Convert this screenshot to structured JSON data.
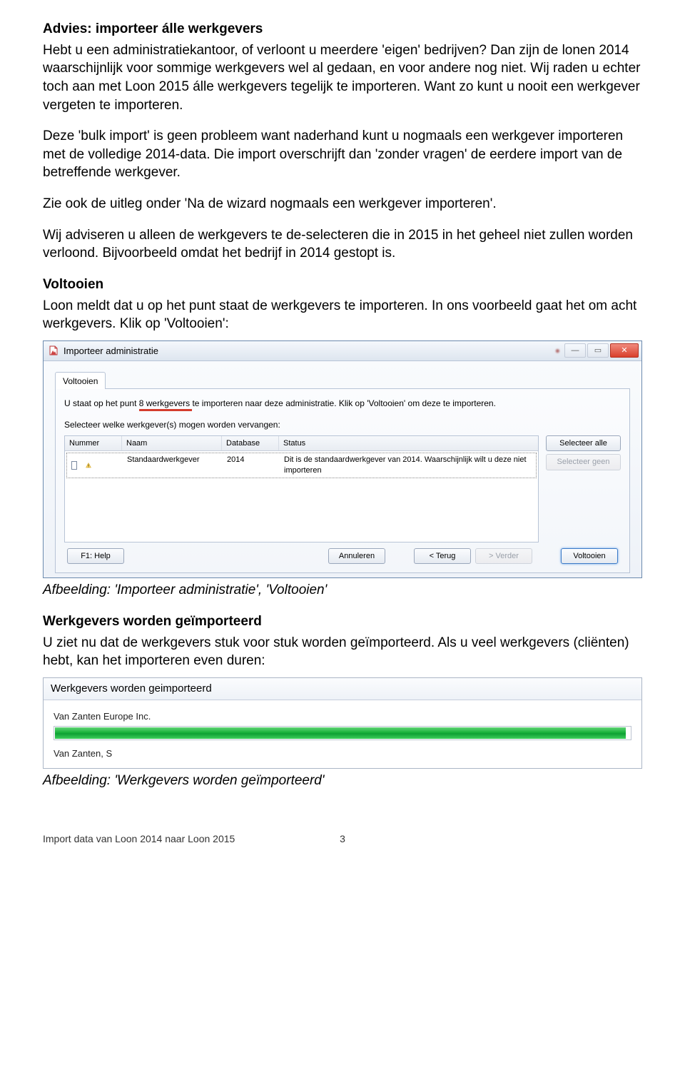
{
  "doc": {
    "h1": "Advies: importeer álle werkgevers",
    "p1": "Hebt u een administratiekantoor, of verloont u meerdere 'eigen' bedrijven? Dan zijn de lonen 2014 waarschijnlijk voor sommige werkgevers wel al gedaan, en voor andere nog niet. Wij raden u echter toch aan met Loon 2015 álle werkgevers tegelijk te importeren. Want zo kunt u nooit een werkgever vergeten te importeren.",
    "p2": "Deze 'bulk import' is geen probleem want naderhand kunt u nogmaals een werkgever importeren met de volledige 2014-data. Die import overschrijft dan 'zonder vragen' de eerdere import van de betreffende werkgever.",
    "p3": "Zie ook de uitleg onder 'Na de wizard nogmaals een werkgever importeren'.",
    "p4": "Wij adviseren u alleen de werkgevers te de-selecteren die in 2015 in het geheel niet zullen worden verloond. Bijvoorbeeld omdat het bedrijf in 2014 gestopt is.",
    "h2": "Voltooien",
    "p5": "Loon meldt dat u op het punt staat de werkgevers te importeren. In ons voorbeeld gaat het om acht werkgevers. Klik op 'Voltooien':",
    "cap1": "Afbeelding: 'Importeer administratie', 'Voltooien'",
    "h3": "Werkgevers worden geïmporteerd",
    "p6": "U ziet nu dat de werkgevers stuk voor stuk worden geïmporteerd. Als u veel werkgevers (cliënten) hebt, kan het importeren even duren:",
    "cap2": "Afbeelding: 'Werkgevers worden geïmporteerd'",
    "footer_left": "Import data van Loon 2014 naar Loon 2015",
    "footer_page": "3"
  },
  "win1": {
    "title": "Importeer administratie",
    "tab": "Voltooien",
    "instr_pre": "U staat op het punt ",
    "instr_highlight": "8 werkgevers ",
    "instr_post": "te importeren naar deze administratie. Klik op 'Voltooien' om deze te importeren.",
    "sub": "Selecteer welke werkgever(s) mogen worden vervangen:",
    "cols": {
      "num": "Nummer",
      "name": "Naam",
      "db": "Database",
      "status": "Status"
    },
    "row": {
      "name": "Standaardwerkgever",
      "db": "2014",
      "status": "Dit is de standaardwerkgever van 2014. Waarschijnlijk wilt u deze niet importeren"
    },
    "btn_selectall": "Selecteer alle",
    "btn_selectnone": "Selecteer geen",
    "btn_help": "F1: Help",
    "btn_cancel": "Annuleren",
    "btn_back": "< Terug",
    "btn_next": "> Verder",
    "btn_finish": "Voltooien"
  },
  "win2": {
    "title": "Werkgevers worden geimporteerd",
    "line1": "Van Zanten Europe Inc.",
    "line2": "Van Zanten, S"
  }
}
